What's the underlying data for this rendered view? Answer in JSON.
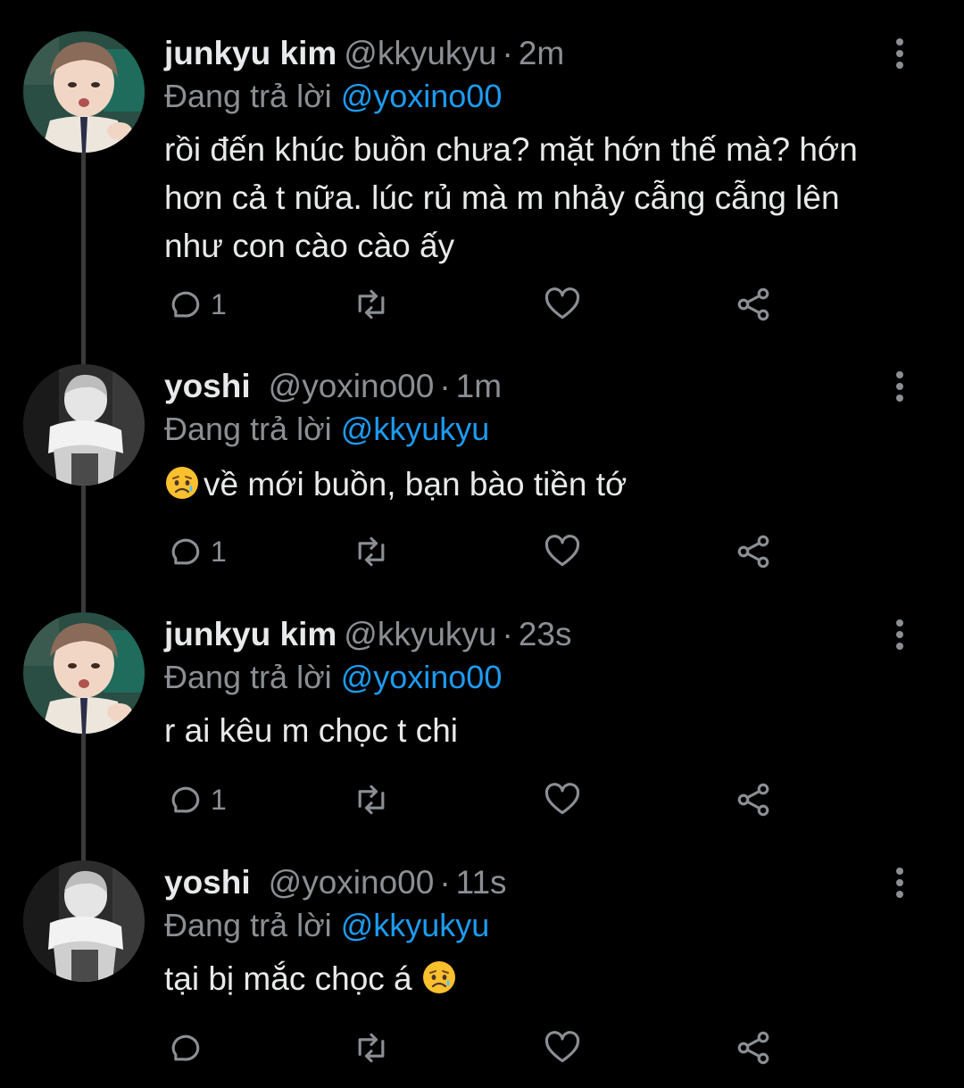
{
  "tweets": [
    {
      "name": "junkyu kim",
      "handle": "@kkyukyu",
      "separator": "·",
      "time": "2m",
      "replying_prefix": "Đang trả lời",
      "replying_to": "@yoxino00",
      "text_lines": [
        "rồi đến khúc buồn chưa? mặt hớn thế mà? hớn",
        "hơn cả t nữa. lúc rủ mà m nhảy cẫng cẫng lên",
        "như con cào cào ấy"
      ],
      "reply_count": "1",
      "avatar": "junkyu-avatar"
    },
    {
      "name": "yoshi",
      "handle": "@yoxino00",
      "separator": "·",
      "time": "1m",
      "replying_prefix": "Đang trả lời",
      "replying_to": "@kkyukyu",
      "text_before_emoji": "",
      "emoji": "sad-but-relieved-face",
      "text": "về mới buồn, bạn bào tiền tớ",
      "reply_count": "1",
      "avatar": "yoshi-avatar"
    },
    {
      "name": "junkyu kim",
      "handle": "@kkyukyu",
      "separator": "·",
      "time": "23s",
      "replying_prefix": "Đang trả lời",
      "replying_to": "@yoxino00",
      "text": "r ai kêu m chọc t chi",
      "reply_count": "1",
      "avatar": "junkyu-avatar"
    },
    {
      "name": "yoshi",
      "handle": "@yoxino00",
      "separator": "·",
      "time": "11s",
      "replying_prefix": "Đang trả lời",
      "replying_to": "@kkyukyu",
      "text": "tại bị mắc chọc á",
      "emoji": "sad-but-relieved-face",
      "reply_count": "",
      "avatar": "yoshi-avatar"
    }
  ],
  "icons": {
    "reply": "reply-icon",
    "retweet": "retweet-icon",
    "like": "heart-icon",
    "share": "share-icon",
    "more": "more-vertical-icon"
  },
  "colors": {
    "background": "#000000",
    "text": "#e7e9ea",
    "muted": "#8b8f94",
    "link": "#1d9bf0",
    "thread_line": "#3a3a3a"
  }
}
